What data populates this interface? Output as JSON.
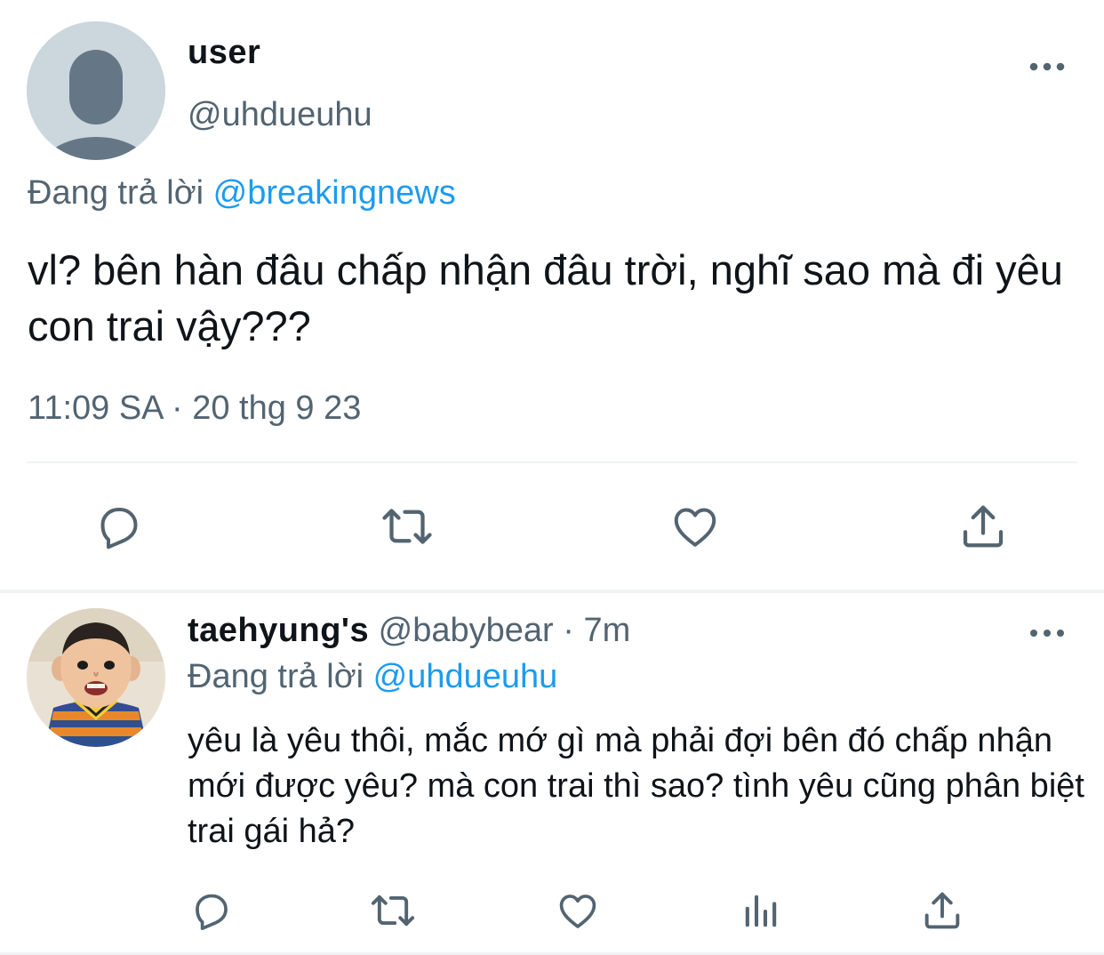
{
  "main_tweet": {
    "name": "user",
    "handle": "@uhdueuhu",
    "replying_prefix": "Đang trả lời",
    "replying_to": "@breakingnews",
    "text": "vl? bên hàn đâu chấp nhận đâu trời, nghĩ sao mà đi yêu con trai vậy???",
    "timestamp": "11:09 SA · 20 thg 9 23",
    "avatar_icon": "default-profile-icon",
    "actions": [
      "reply-icon",
      "retweet-icon",
      "like-icon",
      "share-icon"
    ]
  },
  "reply_tweet": {
    "name": "taehyung's",
    "handle": "@babybear",
    "separator": "·",
    "time": "7m",
    "replying_prefix": "Đang trả lời",
    "replying_to": "@uhdueuhu",
    "text": "yêu là yêu thôi, mắc mớ gì mà phải đợi bên đó chấp nhận mới được yêu? mà con trai thì sao? tình yêu cũng phân biệt trai gái hả?",
    "avatar_icon": "baby-photo-avatar",
    "actions": [
      "reply-icon",
      "retweet-icon",
      "like-icon",
      "analytics-icon",
      "share-icon"
    ]
  },
  "colors": {
    "text": "#0f1419",
    "muted": "#536471",
    "link": "#1d9bf0",
    "divider": "#eff3f4",
    "avatar_bg": "#ccd6dd",
    "avatar_fg": "#657786"
  }
}
